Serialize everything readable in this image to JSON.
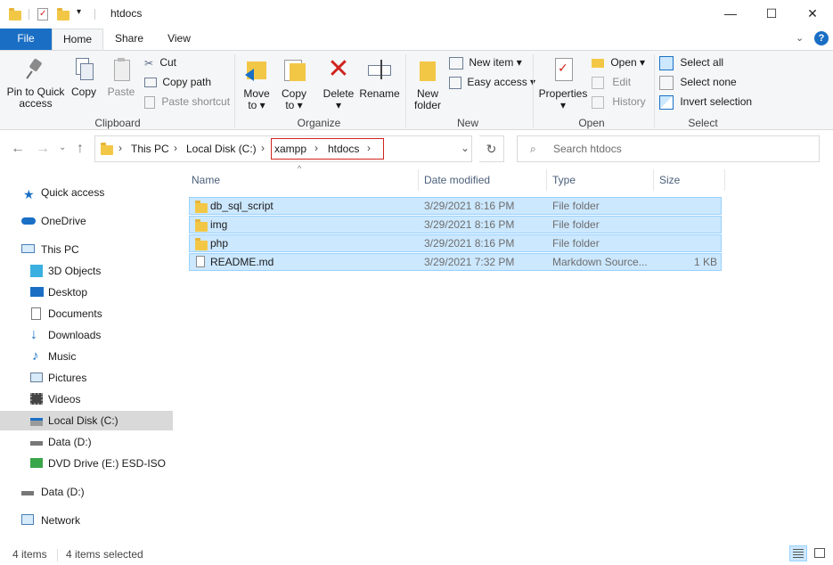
{
  "window": {
    "title": "htdocs",
    "controls": {
      "minimize": "—",
      "maximize": "☐",
      "close": "✕"
    },
    "help": "?"
  },
  "tabs": {
    "file": "File",
    "home": "Home",
    "share": "Share",
    "view": "View"
  },
  "ribbon": {
    "clipboard": {
      "label": "Clipboard",
      "pin_line1": "Pin to Quick",
      "pin_line2": "access",
      "copy": "Copy",
      "paste": "Paste",
      "cut": "Cut",
      "copy_path": "Copy path",
      "paste_shortcut": "Paste shortcut"
    },
    "organize": {
      "label": "Organize",
      "move_line1": "Move",
      "move_line2": "to ▾",
      "copy_line1": "Copy",
      "copy_line2": "to ▾",
      "delete_line1": "Delete",
      "delete_line2": "▾",
      "rename": "Rename"
    },
    "new": {
      "label": "New",
      "new_folder_line1": "New",
      "new_folder_line2": "folder",
      "new_item": "New item ▾",
      "easy_access": "Easy access ▾"
    },
    "open": {
      "label": "Open",
      "properties_line1": "Properties",
      "properties_line2": "▾",
      "open": "Open ▾",
      "edit": "Edit",
      "history": "History"
    },
    "select": {
      "label": "Select",
      "select_all": "Select all",
      "select_none": "Select none",
      "invert": "Invert selection"
    }
  },
  "address": {
    "crumbs": [
      "This PC",
      "Local Disk (C:)",
      "xampp",
      "htdocs"
    ],
    "search_placeholder": "Search htdocs"
  },
  "nav": {
    "quick_access": "Quick access",
    "onedrive": "OneDrive",
    "this_pc": "This PC",
    "objects3d": "3D Objects",
    "desktop": "Desktop",
    "documents": "Documents",
    "downloads": "Downloads",
    "music": "Music",
    "pictures": "Pictures",
    "videos": "Videos",
    "local_disk": "Local Disk (C:)",
    "data_d": "Data (D:)",
    "dvd": "DVD Drive (E:) ESD-ISO",
    "data_d2": "Data (D:)",
    "network": "Network"
  },
  "columns": {
    "name": "Name",
    "date": "Date modified",
    "type": "Type",
    "size": "Size"
  },
  "files": [
    {
      "name": "db_sql_script",
      "date": "3/29/2021 8:16 PM",
      "type": "File folder",
      "size": ""
    },
    {
      "name": "img",
      "date": "3/29/2021 8:16 PM",
      "type": "File folder",
      "size": ""
    },
    {
      "name": "php",
      "date": "3/29/2021 8:16 PM",
      "type": "File folder",
      "size": ""
    },
    {
      "name": "README.md",
      "date": "3/29/2021 7:32 PM",
      "type": "Markdown Source...",
      "size": "1 KB"
    }
  ],
  "status": {
    "items": "4 items",
    "selected": "4 items selected"
  },
  "colors": {
    "accent": "#1a6fc5",
    "selection": "#cce8ff",
    "selection_border": "#99d1ff",
    "highlight_box": "#d0231f",
    "folder": "#f3c746"
  }
}
